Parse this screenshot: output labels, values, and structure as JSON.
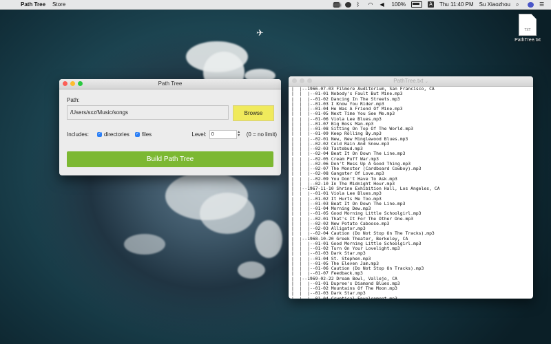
{
  "menubar": {
    "app_name": "Path Tree",
    "menus": [
      "Store"
    ],
    "battery": "100%",
    "datetime": "Thu 11:40 PM",
    "user": "Su Xiaozhou"
  },
  "desktop": {
    "file_label": "PathTree.txt",
    "file_icon_text": "TXT"
  },
  "pathtree_window": {
    "title": "Path Tree",
    "path_label": "Path:",
    "path_value": "/Users/sxz/Music/songs",
    "browse_label": "Browse",
    "includes_label": "Includes:",
    "directories_label": "directories",
    "files_label": "files",
    "level_label": "Level:",
    "level_value": "0",
    "level_hint": "(0 = no limit)",
    "build_label": "Build Path Tree"
  },
  "text_window": {
    "title": "PathTree.txt",
    "lines": [
      "|  |--1966-07-03 Filmore Auditorium, San Francisco, CA",
      "|  |  |--01-01 Nobody's Fault But Mine.mp3",
      "|  |  |--01-02 Dancing In The Streets.mp3",
      "|  |  |--01-03 I Know You Rider.mp3",
      "|  |  |--01-04 He Was A Friend Of Mine.mp3",
      "|  |  |--01-05 Next Time You See Me.mp3",
      "|  |  |--01-06 Viola Lee Blues.mp3",
      "|  |  |--01-07 Big Boss Man.mp3",
      "|  |  |--01-08 Sitting On Top Of The World.mp3",
      "|  |  |--01-09 Keep Rolling By.mp3",
      "|  |  |--02-01 New, New Minglewood Blues.mp3",
      "|  |  |--02-02 Cold Rain And Snow.mp3",
      "|  |  |--02-03 Tastebud.mp3",
      "|  |  |--02-04 Beat It On Down The Line.mp3",
      "|  |  |--02-05 Cream Puff War.mp3",
      "|  |  |--02-06 Don't Mess Up A Good Thing.mp3",
      "|  |  |--02-07 The Monster (Cardboard Cowboy).mp3",
      "|  |  |--02-08 Gangster Of Love.mp3",
      "|  |  |--02-09 You Don't Have To Ask.mp3",
      "|  |  |--02-10 In The Midnight Hour.mp3",
      "|  |--1967-11-10 Shrine Exhibition Hall, Los Angeles, CA",
      "|  |  |--01-01 Viola Lee Blues.mp3",
      "|  |  |--01-02 It Hurts Me Too.mp3",
      "|  |  |--01-03 Beat It On Down The Line.mp3",
      "|  |  |--01-04 Morning Dew.mp3",
      "|  |  |--01-05 Good Morning Little Schoolgirl.mp3",
      "|  |  |--02-01 That's It For The Other One.mp3",
      "|  |  |--02-02 New Potato Caboose.mp3",
      "|  |  |--02-03 Alligator.mp3",
      "|  |  |--02-04 Caution (Do Not Stop On The Tracks).mp3",
      "|  |--1968-10-20 Greek Theater, Berkeley, CA",
      "|  |  |--01-01 Good Morning Little Schoolgirl.mp3",
      "|  |  |--01-02 Turn On Your Lovelight.mp3",
      "|  |  |--01-03 Dark Star.mp3",
      "|  |  |--01-04 St. Stephen.mp3",
      "|  |  |--01-05 The Eleven Jam.mp3",
      "|  |  |--01-06 Caution (Do Not Stop On Tracks).mp3",
      "|  |  |--01-07 Feedback.mp3",
      "|  |--1969-02-22 Dream Bowl, Vallejo, CA",
      "|  |  |--01-01 Dupree's Diamond Blues.mp3",
      "|  |  |--01-02 Mountains Of The Moon.mp3",
      "|  |  |--01-03 Dark Star.mp3",
      "|  |  |--01-04 Cryptical Envelopment.mp3"
    ]
  },
  "colors": {
    "build_button": "#7cb832",
    "browse_button": "#f0ea5c",
    "checkbox": "#2b7ff6"
  }
}
